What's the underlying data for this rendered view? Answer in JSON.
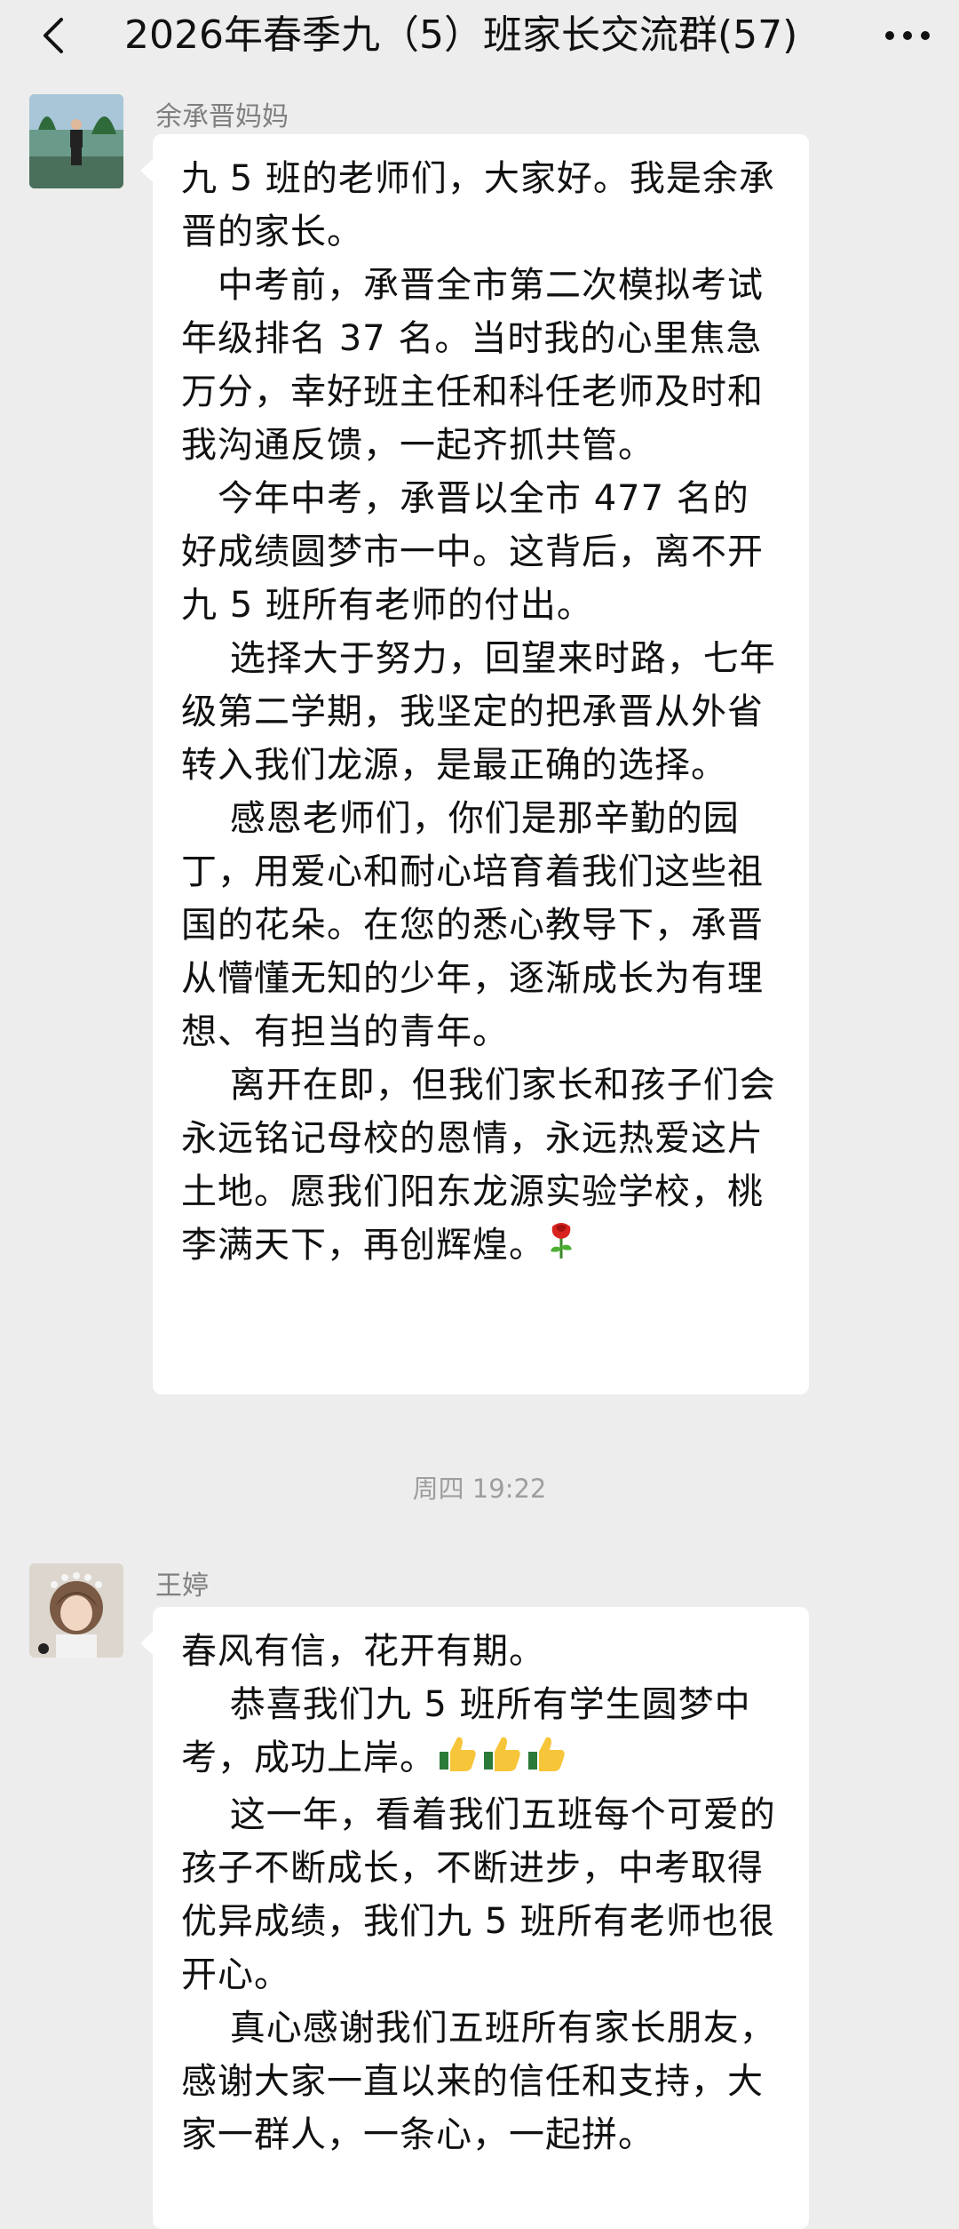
{
  "header": {
    "title": "2026年春季九（5）班家长交流群(57)",
    "back_icon": "chevron-left-icon",
    "more_icon": "more-dots-icon"
  },
  "messages": [
    {
      "sender": "余承晋妈妈",
      "paragraphs": [
        "九 5 班的老师们，大家好。我是余承晋的家长。",
        "　中考前，承晋全市第二次模拟考试年级排名 37 名。当时我的心里焦急万分，幸好班主任和科任老师及时和我沟通反馈，一起齐抓共管。",
        "　今年中考，承晋以全市 477 名的好成绩圆梦市一中。这背后，离不开九 5 班所有老师的付出。",
        "　 选择大于努力，回望来时路，七年级第二学期，我坚定的把承晋从外省转入我们龙源，是最正确的选择。",
        "　 感恩老师们，你们是那辛勤的园丁，用爱心和耐心培育着我们这些祖国的花朵。在您的悉心教导下，承晋从懵懂无知的少年，逐渐成长为有理想、有担当的青年。",
        "　 离开在即，但我们家长和孩子们会永远铭记母校的恩情，永远热爱这片土地。愿我们阳东龙源实验学校，桃李满天下，再创辉煌。"
      ],
      "trailing_emoji": "rose-emoji"
    },
    {
      "sender": "王婷",
      "paragraphs": [
        "春风有信，花开有期。",
        "　 恭喜我们九 5 班所有学生圆梦中考，成功上岸。",
        "　 这一年，看着我们五班每个可爱的孩子不断成长，不断进步，中考取得优异成绩，我们九 5 班所有老师也很开心。",
        "　 真心感谢我们五班所有家长朋友，感谢大家一直以来的信任和支持，大家一群人，一条心，一起拼。"
      ],
      "inline_emoji": "thumbs-up-emoji"
    }
  ],
  "timestamp": "周四 19:22"
}
